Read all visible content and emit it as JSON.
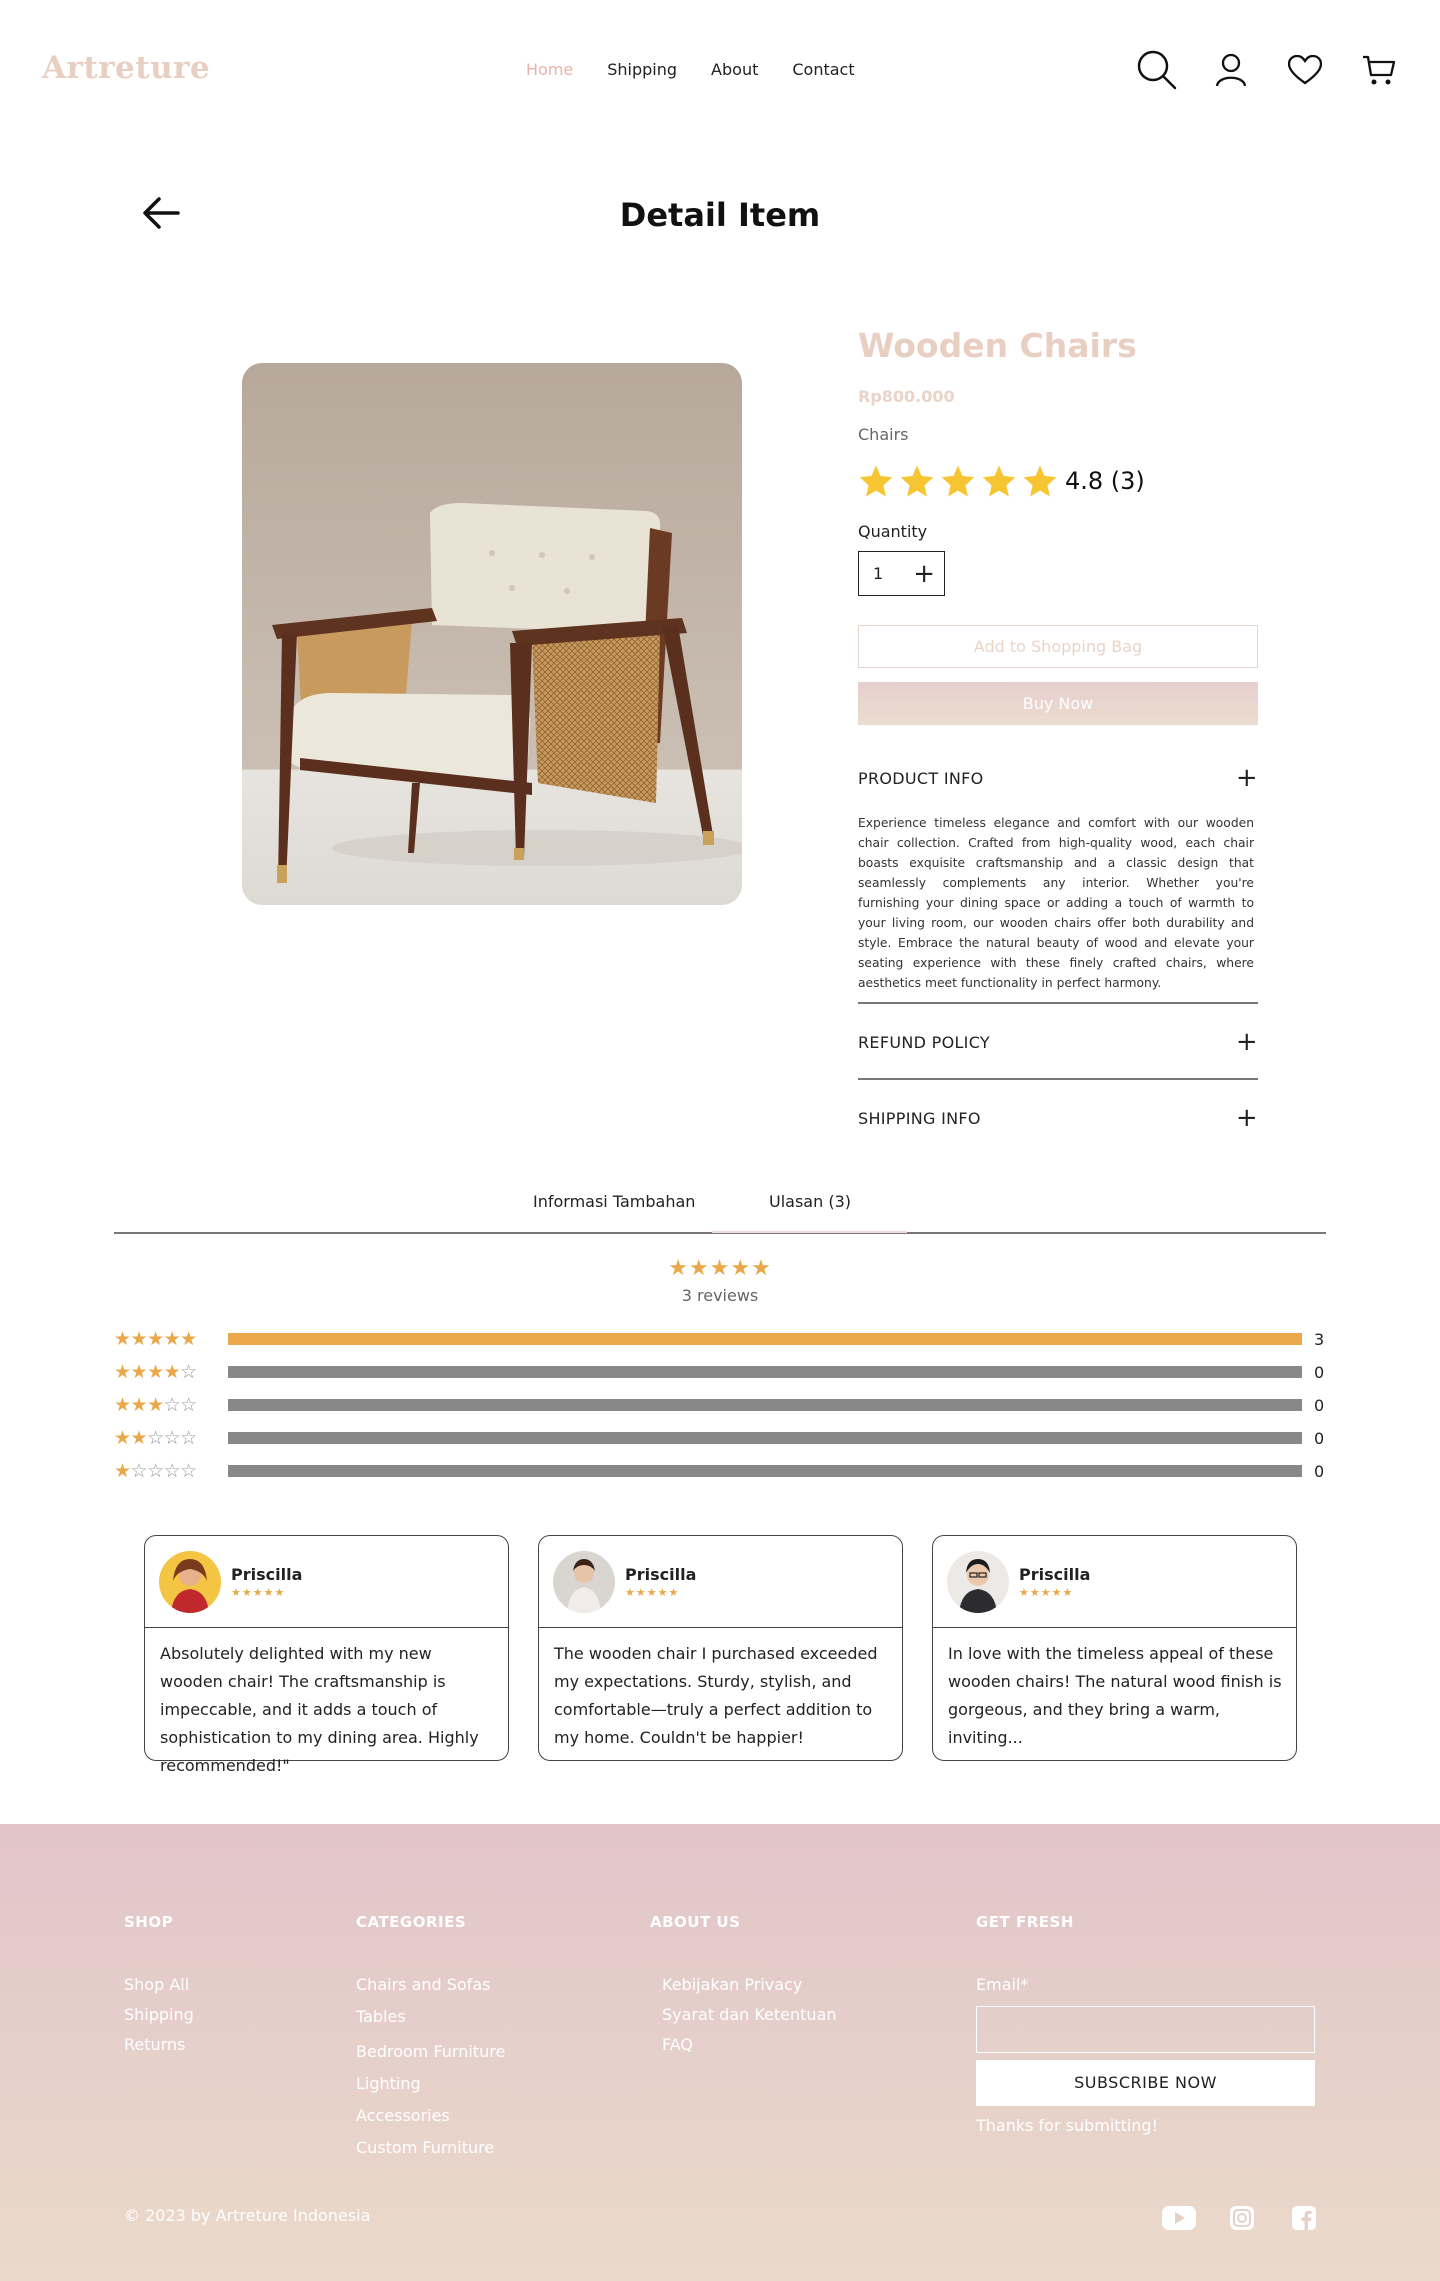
{
  "header": {
    "logo": "Artreture",
    "nav": [
      "Home",
      "Shipping",
      "About",
      "Contact"
    ],
    "icons": [
      "search-icon",
      "user-icon",
      "heart-icon",
      "cart-icon"
    ]
  },
  "page": {
    "title": "Detail Item"
  },
  "product": {
    "name": "Wooden Chairs",
    "price": "Rp800.000",
    "category": "Chairs",
    "rating_text": "4.8 (3)",
    "rating_value": 4.8,
    "quantity_label": "Quantity",
    "quantity": "1",
    "add_to_bag": "Add to Shopping Bag",
    "buy_now": "Buy Now"
  },
  "accordion": {
    "product_info": "PRODUCT INFO",
    "product_info_text": "Experience timeless elegance and comfort with our wooden chair collection. Crafted from high-quality wood, each chair boasts exquisite craftsmanship and a classic design that seamlessly complements any interior. Whether you're furnishing your dining space or adding a touch of warmth to your living room, our wooden chairs offer both durability and style. Embrace the natural beauty of wood and elevate your seating experience with these finely crafted chairs, where aesthetics meet functionality in perfect harmony.",
    "refund_policy": "REFUND POLICY",
    "shipping_info": "SHIPPING INFO"
  },
  "tabs": [
    "Informasi Tambahan",
    "Ulasan (3)"
  ],
  "reviews_summary": {
    "stars": "★★★★★",
    "count_text": "3 reviews",
    "distribution": [
      {
        "stars": 5,
        "count": "3",
        "fraction": 1.0
      },
      {
        "stars": 4,
        "count": "0",
        "fraction": 0
      },
      {
        "stars": 3,
        "count": "0",
        "fraction": 0
      },
      {
        "stars": 2,
        "count": "0",
        "fraction": 0
      },
      {
        "stars": 1,
        "count": "0",
        "fraction": 0
      }
    ]
  },
  "reviews": [
    {
      "name": "Priscilla",
      "stars": "★★★★★",
      "text": "Absolutely delighted with my new wooden chair! The craftsmanship is impeccable, and it adds a touch of sophistication to my dining area. Highly recommended!\""
    },
    {
      "name": "Priscilla",
      "stars": "★★★★★",
      "text": "The wooden chair I purchased exceeded my expectations. Sturdy, stylish, and comfortable—truly a perfect addition to my home. Couldn't be happier!"
    },
    {
      "name": "Priscilla",
      "stars": "★★★★★",
      "text": "In love with the timeless appeal of these wooden chairs! The natural wood finish is gorgeous, and they bring a warm, inviting..."
    }
  ],
  "footer": {
    "shop": {
      "title": "SHOP",
      "links": [
        "Shop All",
        "Shipping",
        "Returns"
      ]
    },
    "categories": {
      "title": "CATEGORIES",
      "links": [
        "Chairs and Sofas",
        "Tables",
        "Bedroom Furniture",
        "Lighting",
        "Accessories",
        "Custom Furniture"
      ]
    },
    "about": {
      "title": "ABOUT US",
      "links": [
        "Kebijakan Privacy",
        "Syarat dan Ketentuan",
        "FAQ"
      ]
    },
    "fresh": {
      "title": "GET FRESH",
      "email_label": "Email*",
      "email_value": "",
      "subscribe": "SUBSCRIBE NOW",
      "thanks": "Thanks for submitting!"
    },
    "copyright": "© 2023 by Artreture Indonesia",
    "social_icons": [
      "youtube-icon",
      "instagram-icon",
      "facebook-icon"
    ]
  },
  "colors": {
    "accent": "#e8cfc1",
    "star": "#eaa84a",
    "rating_star": "#f6c531",
    "footer_top": "#e1c5c8",
    "footer_bottom": "#ebdacb"
  }
}
